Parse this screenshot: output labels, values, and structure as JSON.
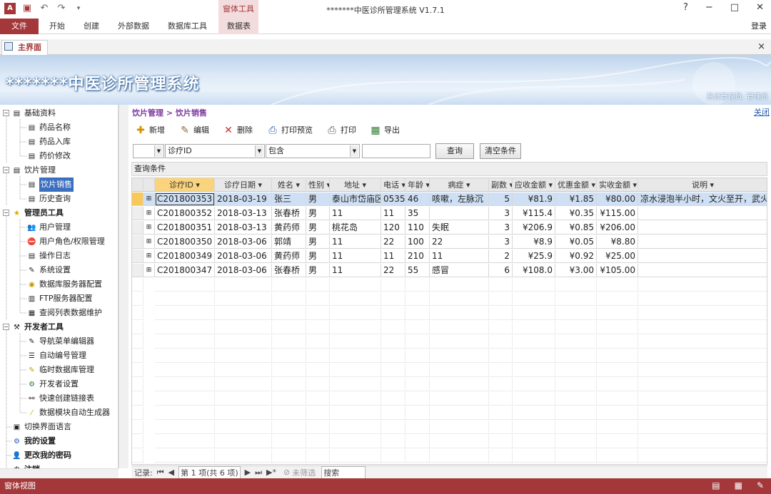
{
  "window": {
    "title": "*******中医诊所管理系统 V1.7.1",
    "context_group": "窗体工具",
    "help": "?",
    "minimize": "−",
    "maximize": "□",
    "close": "✕",
    "login": "登录"
  },
  "ribbon": {
    "file": "文件",
    "tabs": [
      "开始",
      "创建",
      "外部数据",
      "数据库工具",
      "数据表"
    ]
  },
  "doc_tab": {
    "label": "主界面",
    "close": "×"
  },
  "banner": {
    "title": "*******中医诊所管理系统",
    "user": "系统管理员: 管理员"
  },
  "nav": {
    "groups": [
      {
        "label": "基础资料",
        "items": [
          "药品名称",
          "药品入库",
          "药价修改"
        ]
      },
      {
        "label": "饮片管理",
        "items": [
          "饮片销售",
          "历史查询"
        ]
      },
      {
        "label": "管理员工具",
        "items": [
          "用户管理",
          "用户角色/权限管理",
          "操作日志",
          "系统设置",
          "数据库服务器配置",
          "FTP服务器配置",
          "查阅列表数据维护"
        ]
      },
      {
        "label": "开发者工具",
        "items": [
          "导航菜单编辑器",
          "自动编号管理",
          "临时数据库管理",
          "开发者设置",
          "快速创建链接表",
          "数据模块自动生成器"
        ]
      }
    ],
    "bottom": [
      "切换界面语言",
      "我的设置",
      "更改我的密码",
      "注销"
    ],
    "selected": "饮片销售"
  },
  "main": {
    "breadcrumb": "饮片管理 > 饮片销售",
    "close_link": "关闭",
    "toolbar": [
      "新增",
      "编辑",
      "删除",
      "打印预览",
      "打印",
      "导出"
    ],
    "filter": {
      "field": "诊疗ID",
      "operator": "包含",
      "value": "",
      "query_btn": "查询",
      "clear_btn": "清空条件"
    },
    "query_cond_label": "查询条件"
  },
  "grid": {
    "columns": [
      "诊疗ID",
      "诊疗日期",
      "姓名",
      "性别",
      "地址",
      "电话",
      "年龄",
      "病症",
      "副数",
      "应收金额",
      "优惠金额",
      "实收金额",
      "说明"
    ],
    "header_labels": [
      "诊疗ID",
      "诊疗日期",
      "姓名",
      "性别",
      "地址",
      "电话",
      "年龄",
      "病症",
      "副数",
      "应收金额",
      "优惠金额",
      "实收金额",
      "说明"
    ],
    "rows": [
      [
        "C201800353",
        "2018-03-19",
        "张三",
        "男",
        "泰山市岱庙区",
        "0535",
        "46",
        "咳嗽，左脉沉",
        "5",
        "¥81.9",
        "¥1.85",
        "¥80.00",
        "凉水浸泡半小时，文火至开，武火"
      ],
      [
        "C201800352",
        "2018-03-13",
        "张春桥",
        "男",
        "11",
        "11",
        "35",
        "",
        "3",
        "¥115.4",
        "¥0.35",
        "¥115.00",
        ""
      ],
      [
        "C201800351",
        "2018-03-13",
        "黄药师",
        "男",
        "桃花岛",
        "120",
        "110",
        "失眠",
        "3",
        "¥206.9",
        "¥0.85",
        "¥206.00",
        ""
      ],
      [
        "C201800350",
        "2018-03-06",
        "郭靖",
        "男",
        "11",
        "22",
        "100",
        "22",
        "3",
        "¥8.9",
        "¥0.05",
        "¥8.80",
        ""
      ],
      [
        "C201800349",
        "2018-03-06",
        "黄药师",
        "男",
        "11",
        "11",
        "210",
        "11",
        "2",
        "¥25.9",
        "¥0.92",
        "¥25.00",
        ""
      ],
      [
        "C201800347",
        "2018-03-06",
        "张春桥",
        "男",
        "11",
        "22",
        "55",
        "感冒",
        "6",
        "¥108.0",
        "¥3.00",
        "¥105.00",
        ""
      ]
    ]
  },
  "recnav": {
    "label": "记录:",
    "position": "第 1 项(共 6 项)",
    "filter": "未筛选",
    "search": "搜索"
  },
  "status": {
    "text": "窗体视图"
  }
}
